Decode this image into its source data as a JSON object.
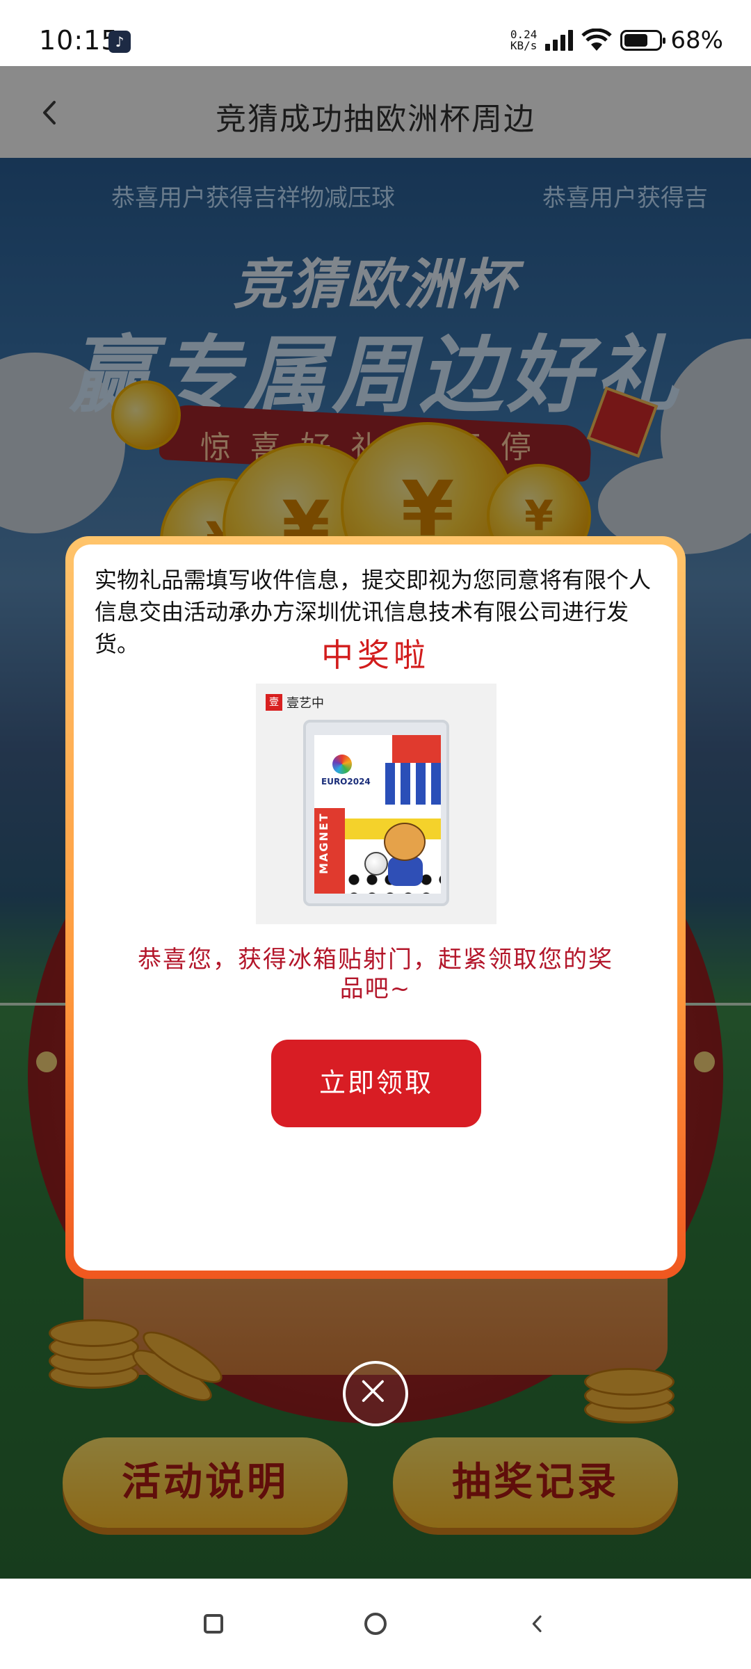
{
  "status_bar": {
    "time": "10:15",
    "app_icon": "tiktok-icon",
    "net_speed_value": "0.24",
    "net_speed_unit": "KB/s",
    "battery_percent": "68%",
    "battery_level": 0.68
  },
  "header": {
    "title": "竞猜成功抽欧洲杯周边"
  },
  "background": {
    "marquee": [
      "恭喜用户获得吉祥物减压球",
      "恭喜用户获得吉"
    ],
    "banner_line1": "竞猜欧洲杯",
    "banner_line2": "赢专属周边好礼",
    "ribbon_text": "惊喜好礼抽不停",
    "buttons": {
      "rules": "活动说明",
      "records": "抽奖记录"
    }
  },
  "modal": {
    "notice": "实物礼品需填写收件信息，提交即视为您同意将有限个人信息交由活动承办方深圳优讯信息技术有限公司进行发货。",
    "heading": "中奖啦",
    "prize_image": {
      "brand": "壹艺中",
      "event": "EURO2024",
      "product_text": "MAGNET"
    },
    "congrats": "恭喜您，获得冰箱贴射门，赶紧领取您的奖品吧~",
    "claim_button": "立即领取"
  },
  "colors": {
    "accent_red": "#d81d24",
    "heading_red": "#d21c1c",
    "modal_border": "#ff9a3d"
  }
}
